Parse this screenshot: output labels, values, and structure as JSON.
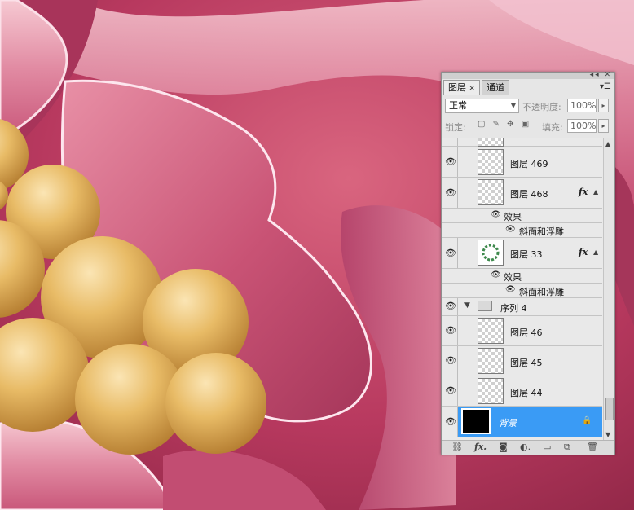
{
  "panel": {
    "tabs": [
      {
        "label": "图层",
        "close": "×",
        "active": true
      },
      {
        "label": "通道",
        "active": false
      }
    ],
    "blend_mode": "正常",
    "opacity_label": "不透明度:",
    "opacity_value": "100%",
    "lock_label": "锁定:",
    "fill_label": "填充:",
    "fill_value": "100%",
    "layers": [
      {
        "name": "图层 469",
        "visible": true,
        "fx": false
      },
      {
        "name": "图层 468",
        "visible": true,
        "fx": true,
        "fx_label": "fx",
        "effects_label": "效果",
        "effects": [
          "斜面和浮雕"
        ]
      },
      {
        "name": "图层 33",
        "visible": true,
        "fx": true,
        "fx_label": "fx",
        "effects_label": "效果",
        "effects": [
          "斜面和浮雕"
        ]
      },
      {
        "name": "序列 4",
        "visible": true,
        "group": true,
        "expanded": true
      },
      {
        "name": "图层 46",
        "visible": true,
        "fx": false
      },
      {
        "name": "图层 45",
        "visible": true,
        "fx": false
      },
      {
        "name": "图层 44",
        "visible": true,
        "fx": false
      },
      {
        "name": "背景",
        "visible": true,
        "fx": false,
        "selected": true,
        "locked": true
      }
    ],
    "footer_icons": [
      "link-icon",
      "fx-icon",
      "mask-icon",
      "adjustment-icon",
      "folder-icon",
      "new-layer-icon",
      "trash-icon"
    ]
  },
  "colors": {
    "selection": "#3a9bf5",
    "canvas_pink": "#c8486f",
    "pearl_gold": "#e2b45c"
  }
}
